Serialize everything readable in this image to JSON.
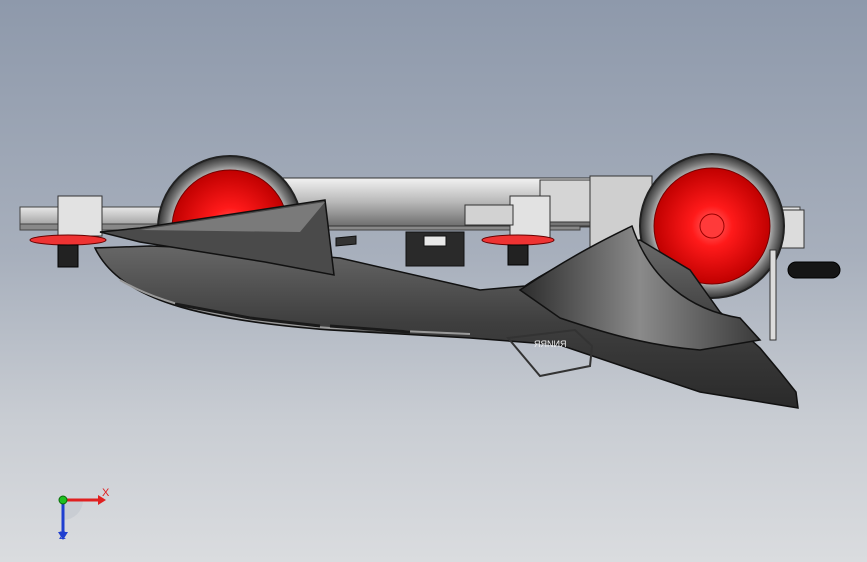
{
  "viewport": {
    "background_top": "#8e99ab",
    "background_bottom": "#dadcdf"
  },
  "model": {
    "part_marking": "ЯЯNИЯ",
    "colors": {
      "wheel_rim": "#ff2020",
      "tire": "#3a3a3a",
      "body": "#4a4a4a",
      "frame": "#c8c8c8"
    }
  },
  "triad": {
    "x_label": "X",
    "z_label": "Z",
    "x_color": "#e02020",
    "y_color": "#20c020",
    "z_color": "#1f3fd0"
  }
}
